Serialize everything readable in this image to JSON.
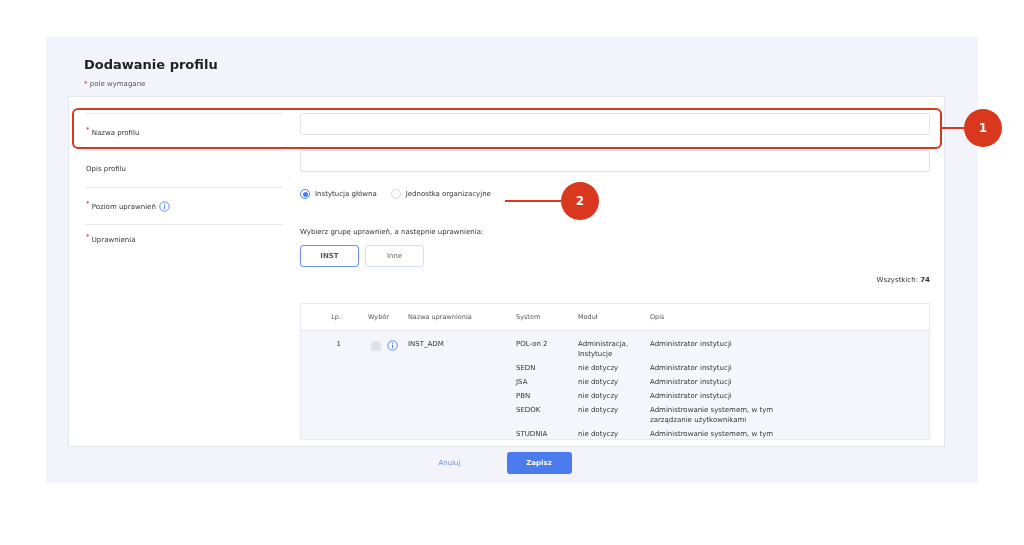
{
  "title": "Dodawanie profilu",
  "required_note": {
    "mark": "*",
    "text": "pole wymagane"
  },
  "fields": [
    {
      "label": "Nazwa profilu",
      "required": true,
      "kind": "text",
      "info": false
    },
    {
      "label": "Opis profilu",
      "required": false,
      "kind": "text",
      "info": false
    },
    {
      "label": "Poziom uprawnień",
      "required": true,
      "kind": "radio",
      "info": true
    },
    {
      "label": "Uprawnienia",
      "required": true,
      "kind": "permissions",
      "info": false
    }
  ],
  "level_options": [
    {
      "label": "Instytucja główna",
      "selected": true
    },
    {
      "label": "Jednostka organizacyjne",
      "selected": false
    }
  ],
  "permissions_prompt": "Wybierz grupę uprawnień, a następnie uprawnienia:",
  "groups": [
    {
      "label": "INST",
      "selected": true
    },
    {
      "label": "Inne",
      "selected": false
    }
  ],
  "total": {
    "label": "Wszystkich:",
    "value": "74"
  },
  "table": {
    "columns": [
      "Lp.",
      "Wybór",
      "Nazwa uprawnienia",
      "System",
      "Moduł",
      "Opis"
    ],
    "rows": [
      {
        "lp": "1",
        "checked": false,
        "name": "INST_ADM",
        "entries": [
          {
            "system": "POL-on 2",
            "module": "Administracja, Instytucje",
            "description": "Administrator instytucji"
          },
          {
            "system": "SEDN",
            "module": "nie dotyczy",
            "description": "Administrator instytucji"
          },
          {
            "system": "JSA",
            "module": "nie dotyczy",
            "description": "Administrator instytucji"
          },
          {
            "system": "PBN",
            "module": "nie dotyczy",
            "description": "Administrator instytucji"
          },
          {
            "system": "SEDOK",
            "module": "nie dotyczy",
            "description": "Administrowanie systemem, w tym zarządzanie użytkownikami"
          },
          {
            "system": "STUDNIA",
            "module": "nie dotyczy",
            "description": "Administrowanie systemem, w tym"
          }
        ]
      }
    ]
  },
  "buttons": [
    {
      "label": "Anuluj",
      "kind": "link"
    },
    {
      "label": "Zapisz",
      "kind": "primary"
    }
  ],
  "callouts": [
    {
      "number": "1"
    },
    {
      "number": "2"
    }
  ]
}
